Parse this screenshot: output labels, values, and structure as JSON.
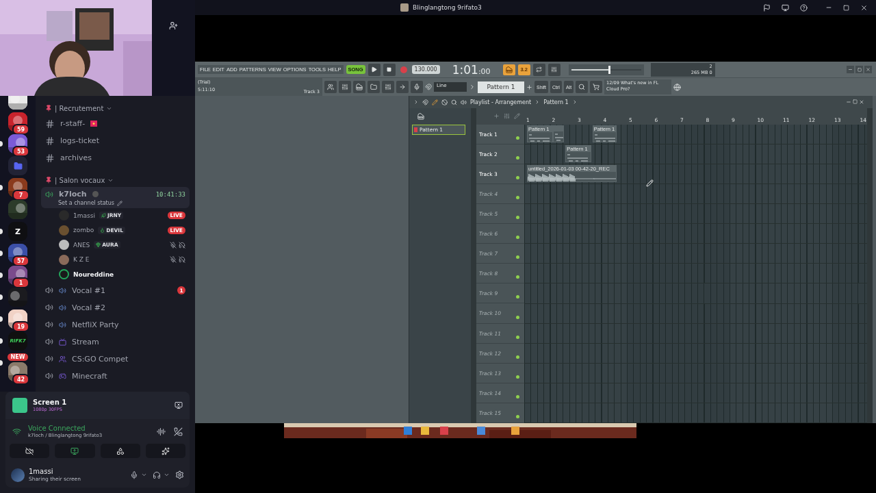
{
  "window": {
    "title": "Blinglangtong 9rifato3"
  },
  "servers": [
    {
      "kind": "picture",
      "unread": false
    },
    {
      "kind": "picture",
      "unread": false,
      "badge": "59"
    },
    {
      "kind": "picture",
      "unread": true,
      "badge": "53"
    },
    {
      "kind": "folder",
      "unread": false
    },
    {
      "kind": "picture",
      "unread": true,
      "badge": "7"
    },
    {
      "kind": "picture",
      "unread": false
    },
    {
      "kind": "letter",
      "label": "Z",
      "unread": true
    },
    {
      "kind": "picture",
      "unread": true,
      "badge": "57"
    },
    {
      "kind": "picture",
      "unread": true,
      "badge": "1"
    },
    {
      "kind": "picture",
      "unread": true
    },
    {
      "kind": "picture",
      "unread": true,
      "badge": "19"
    },
    {
      "kind": "letter",
      "label": "RIFK7",
      "unread": true
    },
    {
      "kind": "picture",
      "unread": true,
      "pill": "NEW",
      "badge": "42"
    }
  ],
  "channel_list": [
    {
      "kind": "category",
      "name": "| Recrutement"
    },
    {
      "kind": "text",
      "name": "r-staff-"
    },
    {
      "kind": "text",
      "name": "logs-ticket"
    },
    {
      "kind": "text",
      "name": "archives"
    },
    {
      "kind": "category",
      "name": "| Salon vocaux"
    },
    {
      "kind": "voice",
      "name": "k7loch",
      "selected": true,
      "time": "10:41:33",
      "status": "Set a channel status",
      "users": [
        {
          "name": "1massi",
          "tag": "JRNY",
          "live_badge": "LIVE",
          "muted": false,
          "speaking": false
        },
        {
          "name": "zombo",
          "tag": "DEVIL",
          "live_badge": "LIVE",
          "muted": false,
          "speaking": false
        },
        {
          "name": "ANES",
          "tag": "AURA",
          "muted": true,
          "speaking": false
        },
        {
          "name": "K Z E",
          "muted": true,
          "speaking": false
        },
        {
          "name": "Noureddine",
          "muted": false,
          "speaking": true
        }
      ]
    },
    {
      "kind": "voice",
      "name": "Vocal #1",
      "selected": false,
      "badge": "1"
    },
    {
      "kind": "voice",
      "name": "Vocal #2",
      "selected": false
    },
    {
      "kind": "voice",
      "name": "NetfliX Party",
      "selected": false
    },
    {
      "kind": "voice",
      "name": "Stream",
      "selected": false
    },
    {
      "kind": "voice",
      "name": "CS:GO Compet",
      "selected": false
    },
    {
      "kind": "voice",
      "name": "Minecraft",
      "selected": false
    }
  ],
  "stream": {
    "title": "Screen 1",
    "quality": "1080p 30FPS"
  },
  "voice": {
    "status": "Voice Connected",
    "channel": "k7loch",
    "server": "/ Blinglangtong 9rifato3"
  },
  "user": {
    "name": "1massi",
    "status": "Sharing their screen"
  },
  "fl": {
    "menu": [
      "FILE",
      "EDIT",
      "ADD",
      "PATTERNS",
      "VIEW",
      "OPTIONS",
      "TOOLS",
      "HELP"
    ],
    "mode": "SONG",
    "tempo": "130.000",
    "time": "1:01",
    "time_ticks": ":00",
    "snap_display": "3.2",
    "hint": {
      "line1": "(Trial)",
      "line2": "5:11:10",
      "track": "Track 3"
    },
    "master_volume": {
      "level": 0.55
    },
    "snap": "Line",
    "pattern": "Pattern 1",
    "modifiers": [
      "Shift",
      "Ctrl",
      "Alt"
    ],
    "news": {
      "date": "12/09",
      "text": "What's new in FL Cloud Pro?"
    },
    "cpu": {
      "voices": "2",
      "memory": "265 MB",
      "poly": "0"
    }
  },
  "playlist": {
    "title": "Playlist - Arrangement",
    "pattern": "Pattern 1",
    "patterns": [
      {
        "name": "Pattern 1",
        "selected": true
      }
    ],
    "bars": [
      "1",
      "2",
      "3",
      "4",
      "5",
      "6",
      "7",
      "8",
      "9",
      "10",
      "11",
      "12",
      "13",
      "14"
    ],
    "tracks": [
      {
        "name": "Track 1",
        "empty": false,
        "clips": [
          {
            "kind": "pattern",
            "label": "Pattern 1"
          },
          {
            "kind": "pattern"
          },
          {
            "kind": "pattern",
            "label": "Pattern 1"
          }
        ]
      },
      {
        "name": "Track 2",
        "empty": false,
        "clips": [
          {
            "kind": "pattern",
            "label": "Pattern 1"
          }
        ]
      },
      {
        "name": "Track 3",
        "empty": false,
        "clips": [
          {
            "kind": "audio",
            "label": "untitled_2026-01-03 00-42-20_REC"
          }
        ]
      },
      {
        "name": "Track 4",
        "empty": true
      },
      {
        "name": "Track 5",
        "empty": true
      },
      {
        "name": "Track 6",
        "empty": true
      },
      {
        "name": "Track 7",
        "empty": true
      },
      {
        "name": "Track 8",
        "empty": true
      },
      {
        "name": "Track 9",
        "empty": true
      },
      {
        "name": "Track 10",
        "empty": true
      },
      {
        "name": "Track 11",
        "empty": true
      },
      {
        "name": "Track 12",
        "empty": true
      },
      {
        "name": "Track 13",
        "empty": true
      },
      {
        "name": "Track 14",
        "empty": true
      },
      {
        "name": "Track 15",
        "empty": true
      }
    ]
  }
}
